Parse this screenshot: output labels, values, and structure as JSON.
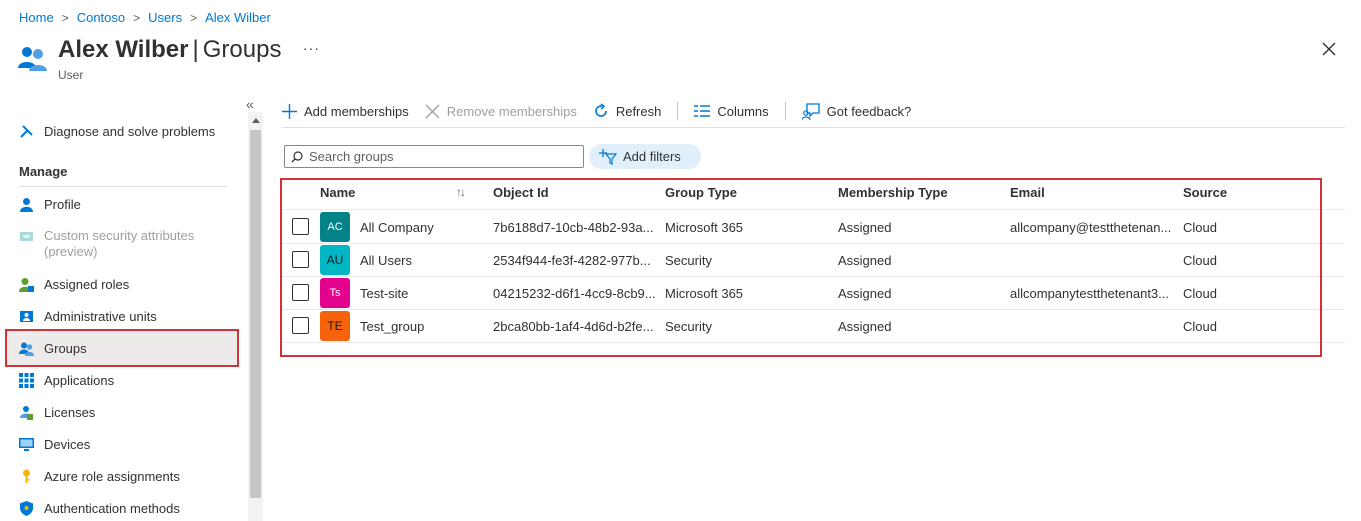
{
  "breadcrumb": {
    "items": [
      "Home",
      "Contoso",
      "Users",
      "Alex Wilber"
    ]
  },
  "header": {
    "name": "Alex Wilber",
    "section": "Groups",
    "subtitle": "User",
    "more": "···"
  },
  "sidebar": {
    "collapse": "«",
    "diagnose": "Diagnose and solve problems",
    "manage_heading": "Manage",
    "items": [
      {
        "label": "Profile",
        "icon": "person-icon"
      },
      {
        "label": "Custom security attributes (preview)",
        "icon": "tag-icon",
        "disabled": true
      },
      {
        "label": "Assigned roles",
        "icon": "roles-icon"
      },
      {
        "label": "Administrative units",
        "icon": "admin-units-icon"
      },
      {
        "label": "Groups",
        "icon": "groups-icon",
        "selected": true
      },
      {
        "label": "Applications",
        "icon": "grid-icon"
      },
      {
        "label": "Licenses",
        "icon": "license-icon"
      },
      {
        "label": "Devices",
        "icon": "monitor-icon"
      },
      {
        "label": "Azure role assignments",
        "icon": "key-icon"
      },
      {
        "label": "Authentication methods",
        "icon": "shield-icon"
      }
    ]
  },
  "toolbar": {
    "add": "Add memberships",
    "remove": "Remove memberships",
    "refresh": "Refresh",
    "columns": "Columns",
    "feedback": "Got feedback?"
  },
  "search": {
    "placeholder": "Search groups",
    "value": ""
  },
  "filter": {
    "label": "Add filters"
  },
  "table": {
    "columns": [
      "Name",
      "Object Id",
      "Group Type",
      "Membership Type",
      "Email",
      "Source"
    ],
    "sort_indicator": "↑↓",
    "rows": [
      {
        "initials": "AC",
        "avatar_color": "#038387",
        "name": "All Company",
        "object_id": "7b6188d7-10cb-48b2-93a...",
        "group_type": "Microsoft 365",
        "membership": "Assigned",
        "email": "allcompany@testthetenan...",
        "source": "Cloud"
      },
      {
        "initials": "AU",
        "avatar_color": "#00b7c3",
        "name": "All Users",
        "object_id": "2534f944-fe3f-4282-977b...",
        "group_type": "Security",
        "membership": "Assigned",
        "email": "",
        "source": "Cloud"
      },
      {
        "initials": "Ts",
        "avatar_color": "#e3008c",
        "name": "Test-site",
        "object_id": "04215232-d6f1-4cc9-8cb9...",
        "group_type": "Microsoft 365",
        "membership": "Assigned",
        "email": "allcompanytestthetenant3...",
        "source": "Cloud"
      },
      {
        "initials": "TE",
        "avatar_color": "#f7630c",
        "name": "Test_group",
        "object_id": "2bca80bb-1af4-4d6d-b2fe...",
        "group_type": "Security",
        "membership": "Assigned",
        "email": "",
        "source": "Cloud"
      }
    ]
  },
  "colors": {
    "accent": "#0078d4",
    "highlight_border": "#d13438"
  }
}
